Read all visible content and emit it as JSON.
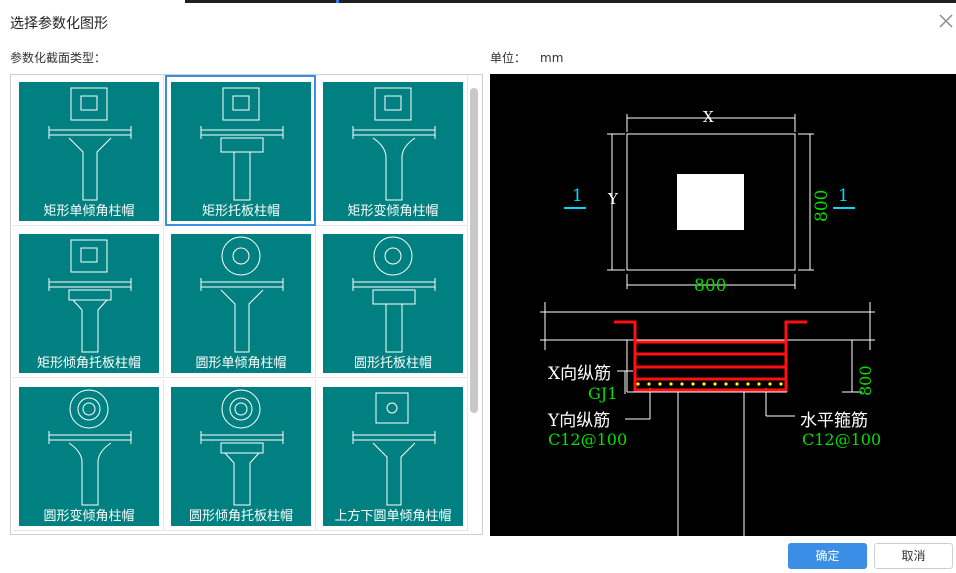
{
  "dialog": {
    "title": "选择参数化图形",
    "section_label": "参数化截面类型：",
    "unit_label": "单位：",
    "unit_value": "mm"
  },
  "shapes": [
    {
      "label": "矩形单倾角柱帽",
      "top": "rect",
      "style": "single"
    },
    {
      "label": "矩形托板柱帽",
      "top": "rect",
      "style": "plate"
    },
    {
      "label": "矩形变倾角柱帽",
      "top": "rect",
      "style": "variable"
    },
    {
      "label": "矩形倾角托板柱帽",
      "top": "rect",
      "style": "angle-plate"
    },
    {
      "label": "圆形单倾角柱帽",
      "top": "circle",
      "style": "single"
    },
    {
      "label": "圆形托板柱帽",
      "top": "circle",
      "style": "plate"
    },
    {
      "label": "圆形变倾角柱帽",
      "top": "circle2",
      "style": "variable"
    },
    {
      "label": "圆形倾角托板柱帽",
      "top": "circle2",
      "style": "angle-plate"
    },
    {
      "label": "上方下圆单倾角柱帽",
      "top": "rect-small",
      "style": "single"
    }
  ],
  "selected_index": 1,
  "preview": {
    "dim_x": "X",
    "dim_y": "Y",
    "dim_width": "800",
    "dim_height": "800",
    "section_mark_left": "1",
    "section_mark_right": "1",
    "dim_depth": "800",
    "x_rebar_label": "X向纵筋",
    "x_rebar_value": "GJ1",
    "y_rebar_label": "Y向纵筋",
    "y_rebar_value": "C12@100",
    "stirrup_label": "水平箍筋",
    "stirrup_value": "C12@100",
    "colors": {
      "line": "#ffffff",
      "green": "#00e000",
      "cyan": "#00d8ff",
      "red": "#ff1010",
      "yellow": "#ffff00"
    }
  },
  "buttons": {
    "ok": "确定",
    "cancel": "取消"
  }
}
